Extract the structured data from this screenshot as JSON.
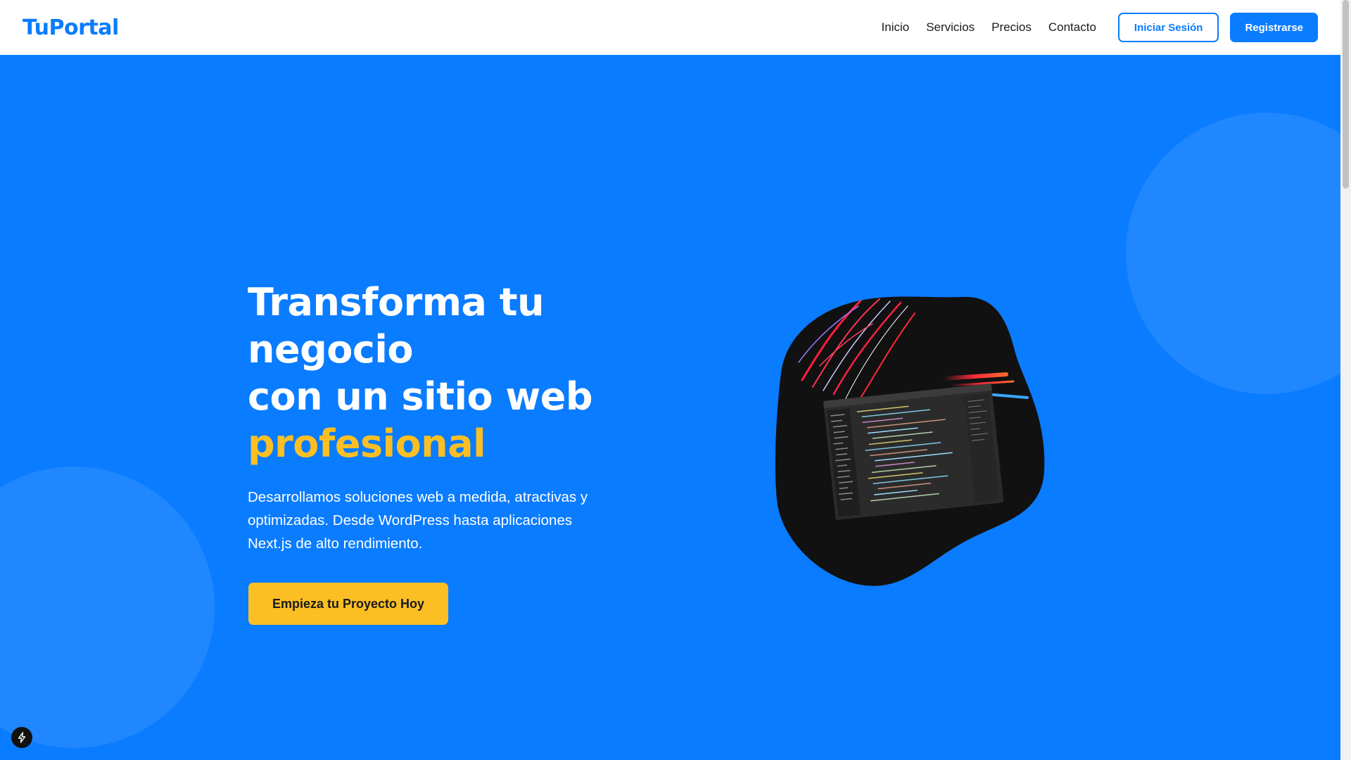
{
  "header": {
    "logo": "TuPortal",
    "nav": [
      {
        "label": "Inicio"
      },
      {
        "label": "Servicios"
      },
      {
        "label": "Precios"
      },
      {
        "label": "Contacto"
      }
    ],
    "login_label": "Iniciar Sesión",
    "register_label": "Registrarse"
  },
  "hero": {
    "title_line1": "Transforma tu negocio",
    "title_line2": "con un sitio web",
    "title_accent": "profesional",
    "description": "Desarrollamos soluciones web a medida, atractivas y optimizadas. Desde WordPress hasta aplicaciones Next.js de alto rendimiento.",
    "cta_label": "Empieza tu Proyecto Hoy",
    "image_icon": "code-editor-image"
  },
  "colors": {
    "brand": "#0a7cff",
    "accent": "#fbbf24",
    "text_dark": "#1a1a1a",
    "white": "#ffffff"
  },
  "badge": {
    "icon": "lightning-icon"
  }
}
